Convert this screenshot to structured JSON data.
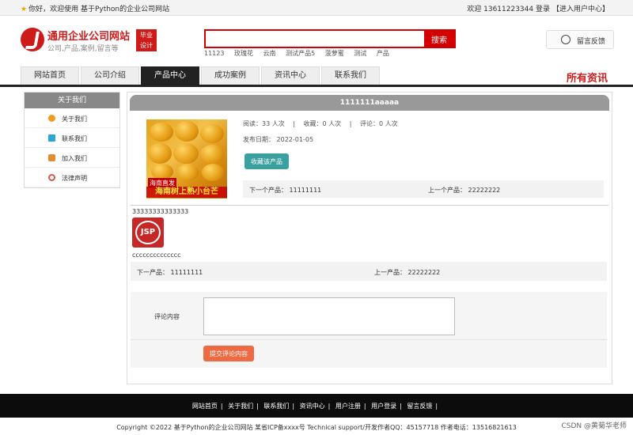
{
  "topbar": {
    "welcome": "你好，欢迎使用 基于Python的企业公司网站",
    "welcome_user": "欢迎 13611223344 登录",
    "user_center": "【进入用户中心】"
  },
  "logo": {
    "name": "通用企业公司网站",
    "slogan": "公司,产品,案例,留言等",
    "badge_line1": "毕业",
    "badge_line2": "设计"
  },
  "search": {
    "placeholder": "",
    "button": "搜索",
    "hot_words": [
      "11123",
      "玫瑰花",
      "云南",
      "测试产品5",
      "菠萝蜜",
      "测试",
      "产品"
    ]
  },
  "feedback_label": "留言反馈",
  "nav": {
    "tabs": [
      "网站首页",
      "公司介绍",
      "产品中心",
      "成功案例",
      "资讯中心",
      "联系我们"
    ],
    "active_index": 2,
    "all_info": "所有资讯"
  },
  "sidebar": {
    "title": "关于我们",
    "items": [
      {
        "label": "关于我们",
        "icon": "sun-icon",
        "color": "#f39a1e"
      },
      {
        "label": "联系我们",
        "icon": "document-icon",
        "color": "#2aa6d6"
      },
      {
        "label": "加入我们",
        "icon": "lock-icon",
        "color": "#e68a2e"
      },
      {
        "label": "法律声明",
        "icon": "power-icon",
        "color": "#d9534f"
      }
    ]
  },
  "product": {
    "title": "1111111aaaaa",
    "views": "阅读：33 人次",
    "favorites": "收藏：0 人次",
    "comments": "评论：0 人次",
    "sep": "|",
    "date": "发布日期： 2022-01-05",
    "fav_button": "收藏该产品",
    "image_caption_small": "海南直发",
    "image_caption_big": "海南树上熟小台芒",
    "next": "下一个产品：  11111111",
    "prev": "上一个产品：  22222222",
    "description": "33333333333333",
    "description2": "cccccccccccccc",
    "jsp_text": "JSP",
    "next2": "下一产品：  11111111",
    "prev2": "上一产品：  22222222"
  },
  "comment": {
    "label": "评论内容",
    "submit": "提交评论内容"
  },
  "footer": {
    "links": [
      "网站首页",
      "关于我们",
      "联系我们",
      "资讯中心",
      "用户注册",
      "用户登录",
      "留言反馈"
    ],
    "copyright": "Copyright ©2022 基于Python的企业公司网站 某省ICP备xxxx号    Technical support/开发作者QQ：45157718      作者电话：13516821613",
    "watermark": "CSDN @黄菊华老师"
  },
  "colors": {
    "brand_red": "#d20000",
    "nav_active": "#222222",
    "fav_button": "#3aa0a0",
    "submit_button": "#ee6a43"
  }
}
